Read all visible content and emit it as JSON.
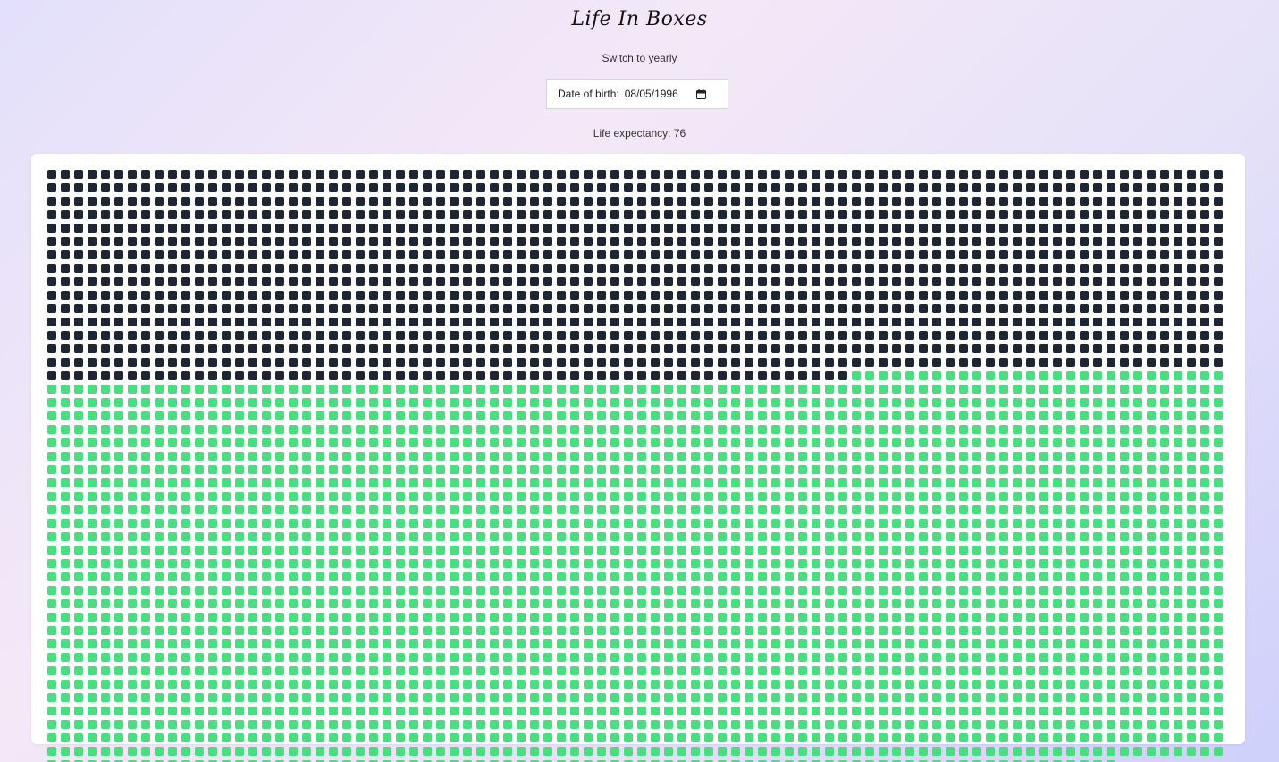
{
  "header": {
    "title": "Life In Boxes",
    "switch_label": "Switch to yearly"
  },
  "dob": {
    "label": "Date of birth:",
    "value": "08/05/1996"
  },
  "expectancy": {
    "text": "Life expectancy: 76"
  },
  "grid": {
    "total_boxes": 3952,
    "lived_boxes": 1380,
    "columns": 88,
    "lived_color": "#1f2633",
    "remaining_color": "#4ade80"
  }
}
